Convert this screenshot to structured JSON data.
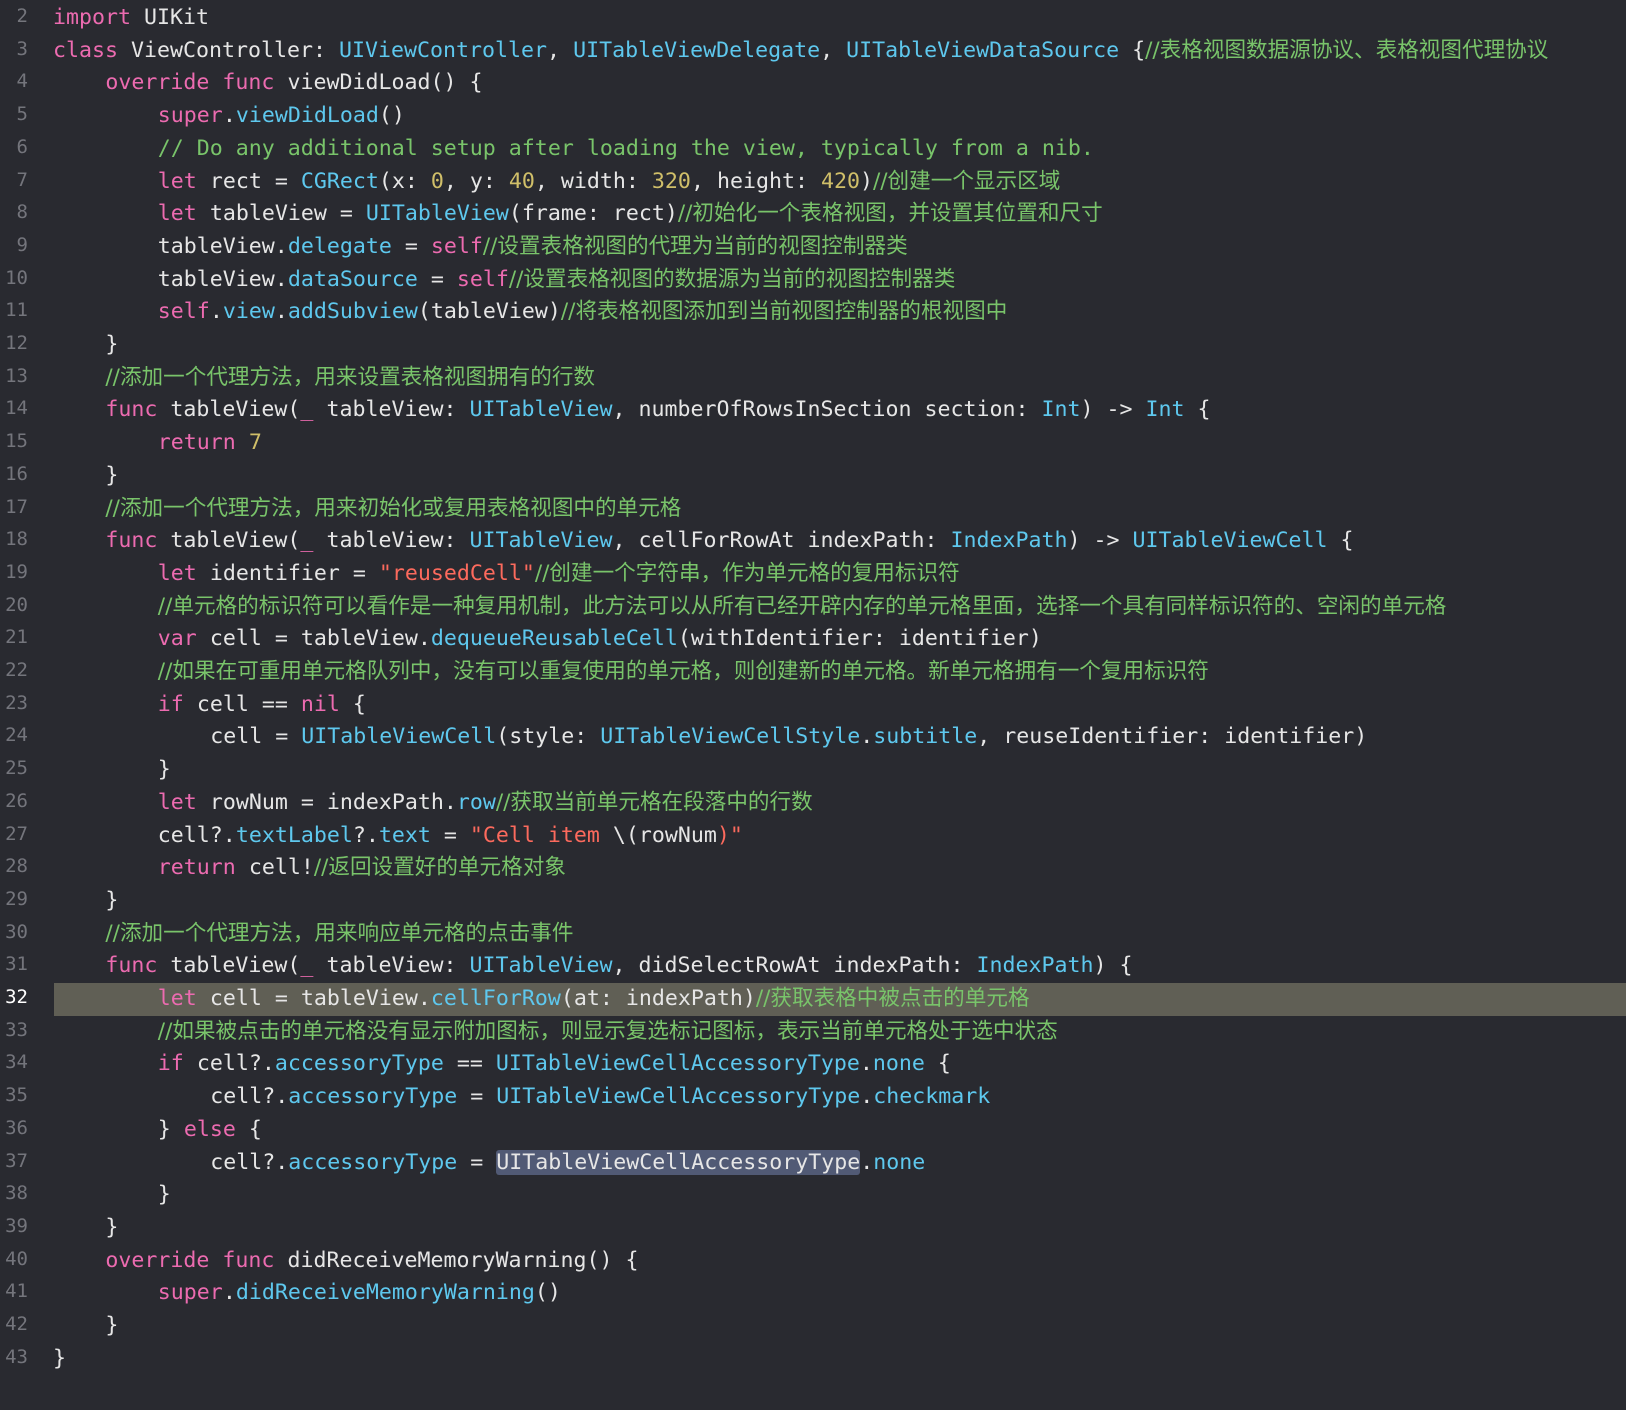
{
  "editor": {
    "language": "swift",
    "current_line": "32",
    "colors": {
      "background": "#292a30",
      "current_line_highlight": "#605f55",
      "keyword": "#ec6bb0",
      "type": "#5ec8ee",
      "comment": "#79c46a",
      "string": "#fc6a5d",
      "number": "#d0bf69",
      "selection": "#515a75"
    },
    "lines": [
      {
        "n": "2",
        "indent": 0,
        "tokens": [
          [
            "kw",
            "import"
          ],
          [
            "pl",
            " UIKit"
          ]
        ]
      },
      {
        "n": "3",
        "indent": 0,
        "tokens": [
          [
            "kw",
            "class"
          ],
          [
            "pl",
            " ViewController: "
          ],
          [
            "ty",
            "UIViewController"
          ],
          [
            "pl",
            ", "
          ],
          [
            "ty",
            "UITableViewDelegate"
          ],
          [
            "pl",
            ", "
          ],
          [
            "ty",
            "UITableViewDataSource"
          ],
          [
            "pl",
            " {"
          ],
          [
            "cm",
            "//表格视图数据源协议、表格视图代理协议"
          ]
        ]
      },
      {
        "n": "4",
        "indent": 1,
        "tokens": [
          [
            "kw",
            "override"
          ],
          [
            "pl",
            " "
          ],
          [
            "kw",
            "func"
          ],
          [
            "pl",
            " viewDidLoad() {"
          ]
        ]
      },
      {
        "n": "5",
        "indent": 2,
        "tokens": [
          [
            "kw",
            "super"
          ],
          [
            "pl",
            "."
          ],
          [
            "fn",
            "viewDidLoad"
          ],
          [
            "pl",
            "()"
          ]
        ]
      },
      {
        "n": "6",
        "indent": 2,
        "tokens": [
          [
            "cmm",
            "// Do any additional setup after loading the view, typically from a nib."
          ]
        ]
      },
      {
        "n": "7",
        "indent": 2,
        "tokens": [
          [
            "kw",
            "let"
          ],
          [
            "pl",
            " rect = "
          ],
          [
            "ty",
            "CGRect"
          ],
          [
            "pl",
            "(x: "
          ],
          [
            "nu",
            "0"
          ],
          [
            "pl",
            ", y: "
          ],
          [
            "nu",
            "40"
          ],
          [
            "pl",
            ", width: "
          ],
          [
            "nu",
            "320"
          ],
          [
            "pl",
            ", height: "
          ],
          [
            "nu",
            "420"
          ],
          [
            "pl",
            ")"
          ],
          [
            "cm",
            "//创建一个显示区域"
          ]
        ]
      },
      {
        "n": "8",
        "indent": 2,
        "tokens": [
          [
            "kw",
            "let"
          ],
          [
            "pl",
            " tableView = "
          ],
          [
            "ty",
            "UITableView"
          ],
          [
            "pl",
            "(frame: rect)"
          ],
          [
            "cm",
            "//初始化一个表格视图，并设置其位置和尺寸"
          ]
        ]
      },
      {
        "n": "9",
        "indent": 2,
        "tokens": [
          [
            "pl",
            "tableView."
          ],
          [
            "fn",
            "delegate"
          ],
          [
            "pl",
            " = "
          ],
          [
            "kw",
            "self"
          ],
          [
            "cm",
            "//设置表格视图的代理为当前的视图控制器类"
          ]
        ]
      },
      {
        "n": "10",
        "indent": 2,
        "tokens": [
          [
            "pl",
            "tableView."
          ],
          [
            "fn",
            "dataSource"
          ],
          [
            "pl",
            " = "
          ],
          [
            "kw",
            "self"
          ],
          [
            "cm",
            "//设置表格视图的数据源为当前的视图控制器类"
          ]
        ]
      },
      {
        "n": "11",
        "indent": 2,
        "tokens": [
          [
            "kw",
            "self"
          ],
          [
            "pl",
            "."
          ],
          [
            "fn",
            "view"
          ],
          [
            "pl",
            "."
          ],
          [
            "fn",
            "addSubview"
          ],
          [
            "pl",
            "(tableView)"
          ],
          [
            "cm",
            "//将表格视图添加到当前视图控制器的根视图中"
          ]
        ]
      },
      {
        "n": "12",
        "indent": 1,
        "tokens": [
          [
            "pl",
            "}"
          ]
        ]
      },
      {
        "n": "13",
        "indent": 1,
        "tokens": [
          [
            "cm",
            "//添加一个代理方法，用来设置表格视图拥有的行数"
          ]
        ]
      },
      {
        "n": "14",
        "indent": 1,
        "tokens": [
          [
            "kw",
            "func"
          ],
          [
            "pl",
            " tableView("
          ],
          [
            "kw",
            "_"
          ],
          [
            "pl",
            " tableView: "
          ],
          [
            "ty",
            "UITableView"
          ],
          [
            "pl",
            ", numberOfRowsInSection section: "
          ],
          [
            "ty",
            "Int"
          ],
          [
            "pl",
            ") -> "
          ],
          [
            "ty",
            "Int"
          ],
          [
            "pl",
            " {"
          ]
        ]
      },
      {
        "n": "15",
        "indent": 2,
        "tokens": [
          [
            "kw",
            "return"
          ],
          [
            "pl",
            " "
          ],
          [
            "nu",
            "7"
          ]
        ]
      },
      {
        "n": "16",
        "indent": 1,
        "tokens": [
          [
            "pl",
            "}"
          ]
        ]
      },
      {
        "n": "17",
        "indent": 1,
        "tokens": [
          [
            "cm",
            "//添加一个代理方法，用来初始化或复用表格视图中的单元格"
          ]
        ]
      },
      {
        "n": "18",
        "indent": 1,
        "tokens": [
          [
            "kw",
            "func"
          ],
          [
            "pl",
            " tableView("
          ],
          [
            "kw",
            "_"
          ],
          [
            "pl",
            " tableView: "
          ],
          [
            "ty",
            "UITableView"
          ],
          [
            "pl",
            ", cellForRowAt indexPath: "
          ],
          [
            "ty",
            "IndexPath"
          ],
          [
            "pl",
            ") -> "
          ],
          [
            "ty",
            "UITableViewCell"
          ],
          [
            "pl",
            " {"
          ]
        ]
      },
      {
        "n": "19",
        "indent": 2,
        "tokens": [
          [
            "kw",
            "let"
          ],
          [
            "pl",
            " identifier = "
          ],
          [
            "st",
            "\"reusedCell\""
          ],
          [
            "cm",
            "//创建一个字符串，作为单元格的复用标识符"
          ]
        ]
      },
      {
        "n": "20",
        "indent": 2,
        "tokens": [
          [
            "cm",
            "//单元格的标识符可以看作是一种复用机制，此方法可以从所有已经开辟内存的单元格里面，选择一个具有同样标识符的、空闲的单元格"
          ]
        ]
      },
      {
        "n": "21",
        "indent": 2,
        "tokens": [
          [
            "kw",
            "var"
          ],
          [
            "pl",
            " cell = tableView."
          ],
          [
            "fn",
            "dequeueReusableCell"
          ],
          [
            "pl",
            "(withIdentifier: identifier)"
          ]
        ]
      },
      {
        "n": "22",
        "indent": 2,
        "tokens": [
          [
            "cm",
            "//如果在可重用单元格队列中，没有可以重复使用的单元格，则创建新的单元格。新单元格拥有一个复用标识符"
          ]
        ]
      },
      {
        "n": "23",
        "indent": 2,
        "tokens": [
          [
            "kw",
            "if"
          ],
          [
            "pl",
            " cell == "
          ],
          [
            "kw",
            "nil"
          ],
          [
            "pl",
            " {"
          ]
        ]
      },
      {
        "n": "24",
        "indent": 3,
        "tokens": [
          [
            "pl",
            "cell = "
          ],
          [
            "ty",
            "UITableViewCell"
          ],
          [
            "pl",
            "(style: "
          ],
          [
            "ty",
            "UITableViewCellStyle"
          ],
          [
            "pl",
            "."
          ],
          [
            "fn",
            "subtitle"
          ],
          [
            "pl",
            ", reuseIdentifier: identifier)"
          ]
        ]
      },
      {
        "n": "25",
        "indent": 2,
        "tokens": [
          [
            "pl",
            "}"
          ]
        ]
      },
      {
        "n": "26",
        "indent": 2,
        "tokens": [
          [
            "kw",
            "let"
          ],
          [
            "pl",
            " rowNum = indexPath."
          ],
          [
            "fn",
            "row"
          ],
          [
            "cm",
            "//获取当前单元格在段落中的行数"
          ]
        ]
      },
      {
        "n": "27",
        "indent": 2,
        "tokens": [
          [
            "pl",
            "cell?."
          ],
          [
            "fn",
            "textLabel"
          ],
          [
            "pl",
            "?."
          ],
          [
            "fn",
            "text"
          ],
          [
            "pl",
            " = "
          ],
          [
            "st",
            "\"Cell item "
          ],
          [
            "pl",
            "\\("
          ],
          [
            "pl",
            "rowNum"
          ],
          [
            "st",
            ")\""
          ]
        ]
      },
      {
        "n": "28",
        "indent": 2,
        "tokens": [
          [
            "kw",
            "return"
          ],
          [
            "pl",
            " cell!"
          ],
          [
            "cm",
            "//返回设置好的单元格对象"
          ]
        ]
      },
      {
        "n": "29",
        "indent": 1,
        "tokens": [
          [
            "pl",
            "}"
          ]
        ]
      },
      {
        "n": "30",
        "indent": 1,
        "tokens": [
          [
            "cm",
            "//添加一个代理方法，用来响应单元格的点击事件"
          ]
        ]
      },
      {
        "n": "31",
        "indent": 1,
        "tokens": [
          [
            "kw",
            "func"
          ],
          [
            "pl",
            " tableView("
          ],
          [
            "kw",
            "_"
          ],
          [
            "pl",
            " tableView: "
          ],
          [
            "ty",
            "UITableView"
          ],
          [
            "pl",
            ", didSelectRowAt indexPath: "
          ],
          [
            "ty",
            "IndexPath"
          ],
          [
            "pl",
            ") {"
          ]
        ]
      },
      {
        "n": "32",
        "indent": 2,
        "tokens": [
          [
            "kw",
            "let"
          ],
          [
            "pl",
            " cell = tableView."
          ],
          [
            "fn",
            "cellForRow"
          ],
          [
            "pl",
            "(at: indexPath)"
          ],
          [
            "cm",
            "//获取表格中被点击的单元格"
          ]
        ]
      },
      {
        "n": "33",
        "indent": 2,
        "tokens": [
          [
            "cm",
            "//如果被点击的单元格没有显示附加图标，则显示复选标记图标，表示当前单元格处于选中状态"
          ]
        ]
      },
      {
        "n": "34",
        "indent": 2,
        "tokens": [
          [
            "kw",
            "if"
          ],
          [
            "pl",
            " cell?."
          ],
          [
            "fn",
            "accessoryType"
          ],
          [
            "pl",
            " == "
          ],
          [
            "ty",
            "UITableViewCellAccessoryType"
          ],
          [
            "pl",
            "."
          ],
          [
            "fn",
            "none"
          ],
          [
            "pl",
            " {"
          ]
        ]
      },
      {
        "n": "35",
        "indent": 3,
        "tokens": [
          [
            "pl",
            "cell?."
          ],
          [
            "fn",
            "accessoryType"
          ],
          [
            "pl",
            " = "
          ],
          [
            "ty",
            "UITableViewCellAccessoryType"
          ],
          [
            "pl",
            "."
          ],
          [
            "fn",
            "checkmark"
          ]
        ]
      },
      {
        "n": "36",
        "indent": 2,
        "tokens": [
          [
            "pl",
            "} "
          ],
          [
            "kw",
            "else"
          ],
          [
            "pl",
            " {"
          ]
        ]
      },
      {
        "n": "37",
        "indent": 3,
        "tokens": [
          [
            "pl",
            "cell?."
          ],
          [
            "fn",
            "accessoryType"
          ],
          [
            "pl",
            " = "
          ],
          [
            "sel",
            "UITableViewCellAccessoryType"
          ],
          [
            "pl",
            "."
          ],
          [
            "fn",
            "none"
          ]
        ]
      },
      {
        "n": "38",
        "indent": 2,
        "tokens": [
          [
            "pl",
            "}"
          ]
        ]
      },
      {
        "n": "39",
        "indent": 1,
        "tokens": [
          [
            "pl",
            "}"
          ]
        ]
      },
      {
        "n": "40",
        "indent": 1,
        "tokens": [
          [
            "kw",
            "override"
          ],
          [
            "pl",
            " "
          ],
          [
            "kw",
            "func"
          ],
          [
            "pl",
            " didReceiveMemoryWarning() {"
          ]
        ]
      },
      {
        "n": "41",
        "indent": 2,
        "tokens": [
          [
            "kw",
            "super"
          ],
          [
            "pl",
            "."
          ],
          [
            "fn",
            "didReceiveMemoryWarning"
          ],
          [
            "pl",
            "()"
          ]
        ]
      },
      {
        "n": "42",
        "indent": 1,
        "tokens": [
          [
            "pl",
            "}"
          ]
        ]
      },
      {
        "n": "43",
        "indent": 0,
        "tokens": [
          [
            "pl",
            "}"
          ]
        ]
      }
    ]
  }
}
